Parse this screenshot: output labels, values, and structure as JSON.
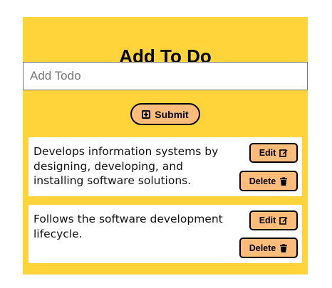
{
  "header": {
    "title": "Add To Do"
  },
  "form": {
    "input_placeholder": "Add Todo",
    "input_value": "",
    "submit_label": "Submit",
    "submit_icon": "plus-square-icon"
  },
  "todos": [
    {
      "text": "Develops information systems by designing, developing, and installing software solutions.",
      "edit_label": "Edit",
      "edit_icon": "edit-icon",
      "delete_label": "Delete",
      "delete_icon": "trash-icon"
    },
    {
      "text": "Follows the software development lifecycle.",
      "edit_label": "Edit",
      "edit_icon": "edit-icon",
      "delete_label": "Delete",
      "delete_icon": "trash-icon"
    }
  ],
  "colors": {
    "panel_background": "#ffd43b",
    "button_background": "#fdbc7a",
    "card_background": "#ffffff",
    "border": "#000000"
  }
}
